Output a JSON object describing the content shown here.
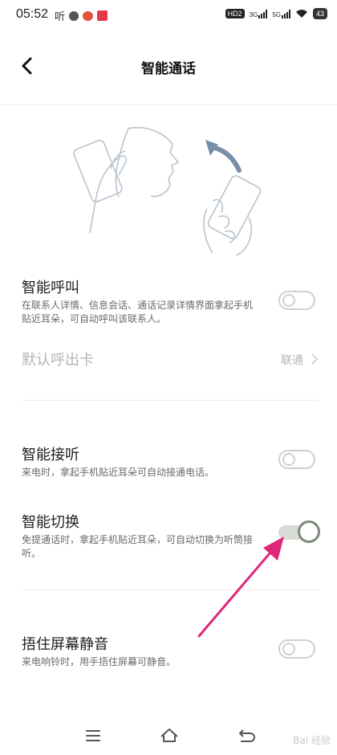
{
  "status_bar": {
    "time": "05:52",
    "listen_label": "听",
    "hd": "HD2",
    "net1": "3G",
    "net2": "5G",
    "battery": "43"
  },
  "header": {
    "title": "智能通话"
  },
  "settings": {
    "smart_call": {
      "title": "智能呼叫",
      "desc": "在联系人详情、信息会话、通话记录详情界面拿起手机贴近耳朵，可自动呼叫该联系人。",
      "enabled": false
    },
    "default_sim": {
      "title": "默认呼出卡",
      "value": "联通"
    },
    "smart_answer": {
      "title": "智能接听",
      "desc": "来电时，拿起手机贴近耳朵可自动接通电话。",
      "enabled": false
    },
    "smart_switch": {
      "title": "智能切换",
      "desc": "免提通话时，拿起手机贴近耳朵，可自动切换为听筒接听。",
      "enabled": true
    },
    "cover_mute": {
      "title": "捂住屏幕静音",
      "desc": "来电响铃时，用手捂住屏幕可静音。",
      "enabled": false
    }
  },
  "watermark": "Bai 经验",
  "colors": {
    "annotation_arrow": "#e0287a",
    "toggle_on_knob": "#7c8a79"
  }
}
